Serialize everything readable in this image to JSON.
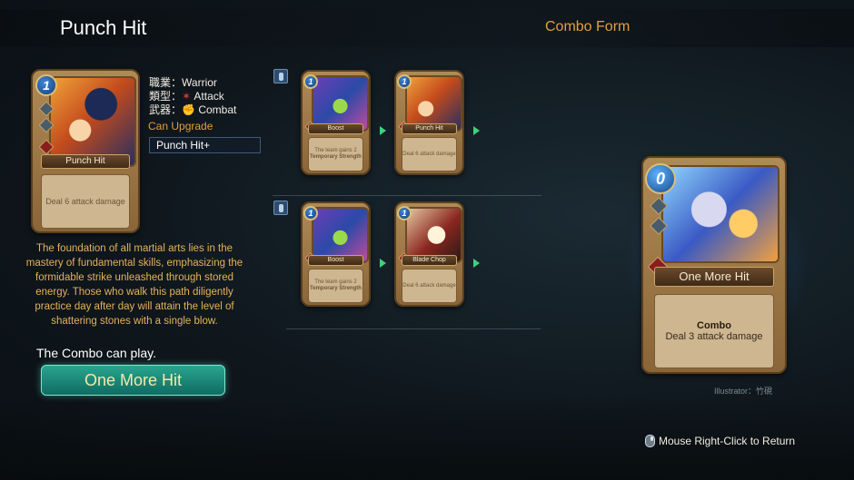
{
  "header": {
    "title": "Punch Hit",
    "combo_form": "Combo Form"
  },
  "main_card": {
    "cost": "1",
    "name": "Punch Hit",
    "description": "Deal 6 attack damage"
  },
  "info": {
    "class_key": "職業：",
    "class_val": "Warrior",
    "type_key": "類型：",
    "type_val": "Attack",
    "weapon_key": "武器：",
    "weapon_val": "Combat"
  },
  "upgrade": {
    "label": "Can Upgrade",
    "value": "Punch Hit+"
  },
  "lore": "The foundation of all martial arts lies in the mastery of fundamental skills, emphasizing the formidable strike unleashed through stored energy. Those who walk this path diligently practice day after day will attain the level of shattering stones with a single blow.",
  "combo": {
    "can_play": "The Combo can play.",
    "button": "One More Hit"
  },
  "paths": [
    {
      "cards": [
        {
          "cost": "1",
          "name": "Boost",
          "desc1": "The team gains 2",
          "desc2": "Temporary Strength"
        },
        {
          "cost": "1",
          "name": "Punch Hit",
          "desc1": "Deal 6 attack damage",
          "desc2": ""
        }
      ]
    },
    {
      "cards": [
        {
          "cost": "1",
          "name": "Boost",
          "desc1": "The team gains 2",
          "desc2": "Temporary Strength"
        },
        {
          "cost": "1",
          "name": "Blade Chop",
          "desc1": "Deal 6 attack damage",
          "desc2": ""
        }
      ]
    }
  ],
  "big_card": {
    "cost": "0",
    "name": "One More Hit",
    "desc_title": "Combo",
    "desc": "Deal 3 attack damage"
  },
  "illustrator": "Illustrator：竹硯",
  "return_hint": "Mouse Right-Click to Return"
}
